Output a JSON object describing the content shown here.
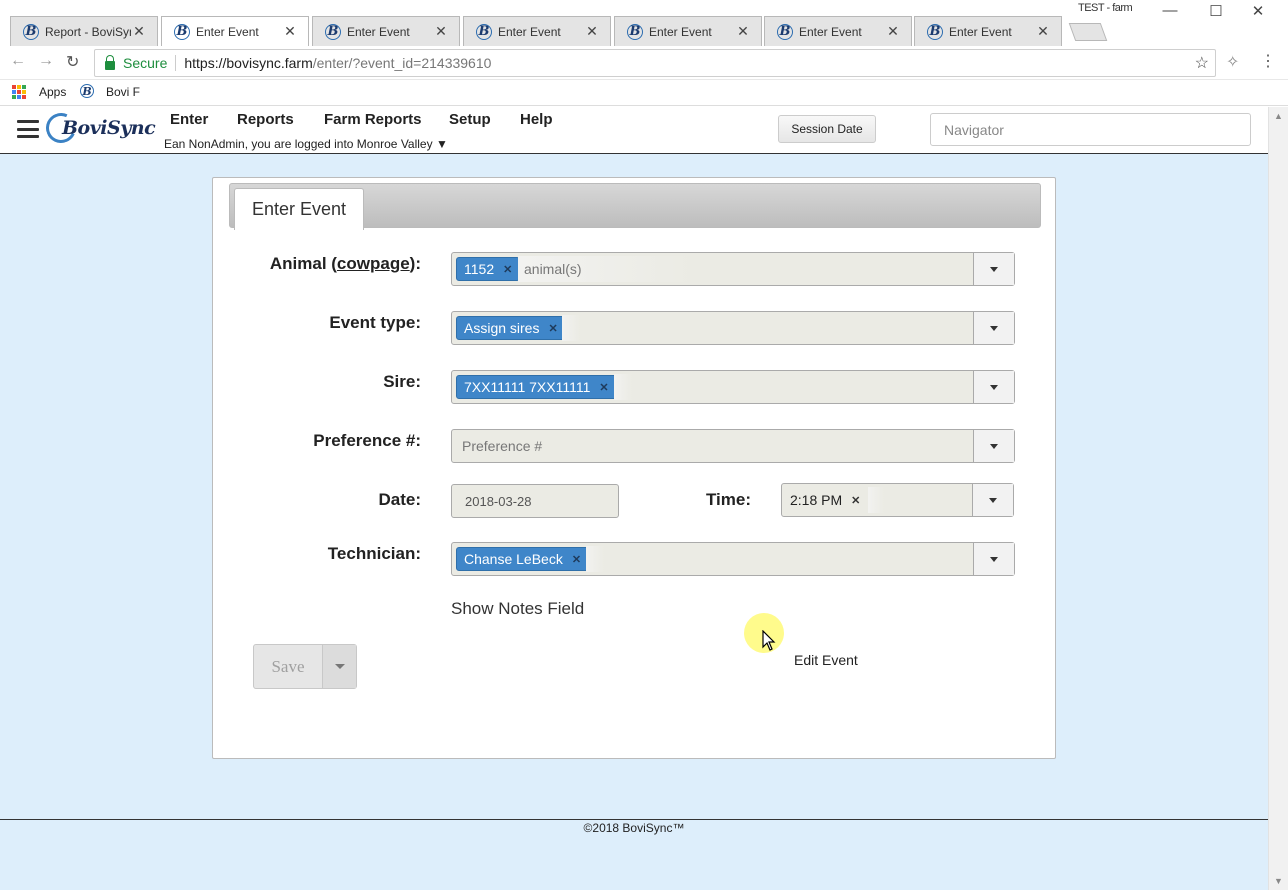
{
  "browser": {
    "tabs": [
      {
        "title": "Report - BoviSync"
      },
      {
        "title": "Enter Event"
      },
      {
        "title": "Enter Event"
      },
      {
        "title": "Enter Event"
      },
      {
        "title": "Enter Event"
      },
      {
        "title": "Enter Event"
      },
      {
        "title": "Enter Event"
      }
    ],
    "active_tab": 1,
    "profile": "TEST - farm",
    "secure_label": "Secure",
    "url_host": "https://bovisync.farm",
    "url_path": "/enter/?event_id=214339610",
    "bookmarks": {
      "apps": "Apps",
      "bovi": "Bovi F"
    }
  },
  "app": {
    "menu": [
      "Enter",
      "Reports",
      "Farm Reports",
      "Setup",
      "Help"
    ],
    "logged_in": "Ean NonAdmin, you are logged into Monroe Valley ▼",
    "session_date": "Session Date",
    "navigator_placeholder": "Navigator",
    "logo_text": "BoviSync"
  },
  "form": {
    "tab_label": "Enter Event",
    "animal_label_pre": "Animal (",
    "animal_label_link": "cowpage",
    "animal_label_post": "):",
    "animal_chip": "1152",
    "animal_placeholder": "animal(s)",
    "event_type_label": "Event type:",
    "event_type_chip": "Assign sires",
    "sire_label": "Sire:",
    "sire_chip": "7XX11111 7XX11111",
    "preference_label": "Preference #:",
    "preference_placeholder": "Preference #",
    "date_label": "Date:",
    "date_value": "2018-03-28",
    "time_label": "Time:",
    "time_chip": "2:18 PM",
    "technician_label": "Technician:",
    "technician_chip": "Chanse LeBeck",
    "show_notes": "Show Notes Field",
    "save": "Save",
    "edit_event": "Edit Event"
  },
  "footer": "©2018 BoviSync™",
  "colors": {
    "chip": "#3f86c9",
    "page_bg": "#ddeefb",
    "secure": "#1e8e3e"
  }
}
